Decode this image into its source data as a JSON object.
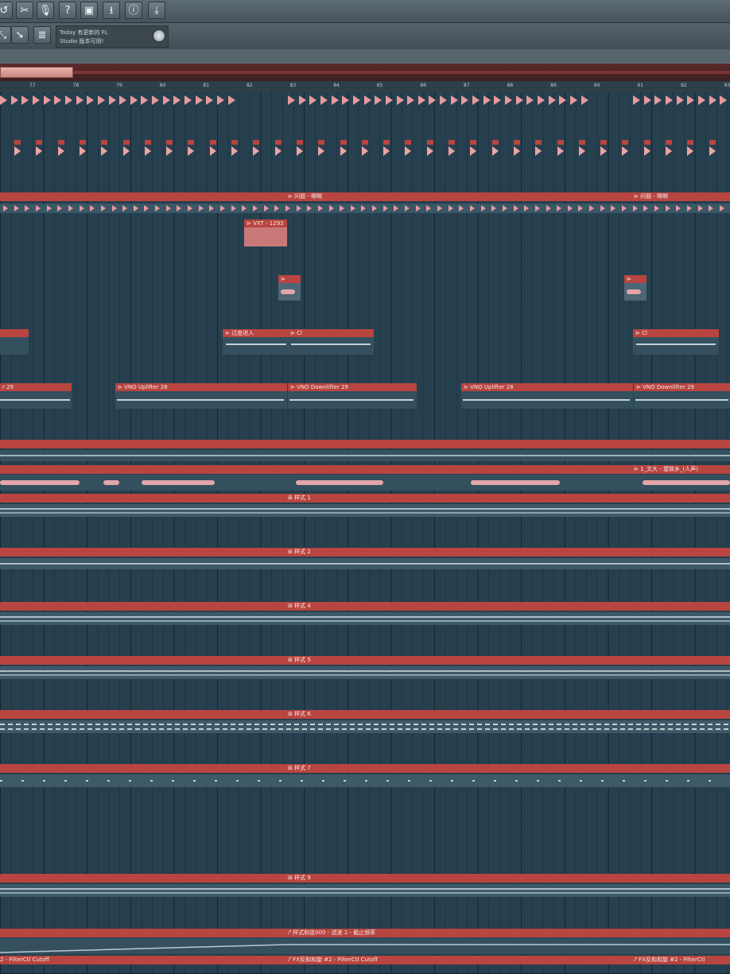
{
  "toolbar": {
    "buttons": [
      {
        "name": "undo-icon",
        "glyph": "↺"
      },
      {
        "name": "cut-icon",
        "glyph": "✂"
      },
      {
        "name": "microphone-icon",
        "glyph": "🎙"
      },
      {
        "name": "help-icon",
        "glyph": "?"
      },
      {
        "name": "save-icon",
        "glyph": "▣"
      },
      {
        "name": "export-icon",
        "glyph": "⭳"
      },
      {
        "name": "info-icon",
        "glyph": "ⓘ"
      },
      {
        "name": "download-icon",
        "glyph": "⤓"
      }
    ]
  },
  "hint_panel": {
    "line1": "Today  有更新的 FL",
    "line2": "Studio 版本可用!"
  },
  "ruler": {
    "labels": [
      "77",
      "78",
      "79",
      "80",
      "81",
      "82",
      "83",
      "84",
      "85",
      "86",
      "87",
      "88",
      "89",
      "90",
      "91",
      "92",
      "93"
    ]
  },
  "clips": {
    "band1_label": "⊳ 问题 - 嘶嘶",
    "band1_label_b": "⊳ 问题 - 嘶嘶",
    "vxt": "⊳ VXT - 1293",
    "transition": "⊳ 过度进入",
    "cl1": "⊳ Cl",
    "cl2": "⊳ Cl",
    "left_29": "r 29",
    "uplifter1": "⊳ VNO Uplifter 28",
    "downlifter1": "⊳ VNO Downlifter 29",
    "uplifter2": "⊳ VNO Uplifter 28",
    "downlifter2": "⊳ VNO Downlifter 29",
    "audio_right": "⊳ 1_文大 - 望故乡_(人声)",
    "pattern1": "⊞ 样式 1",
    "pattern2": "⊞ 样式 2",
    "pattern4": "⊞ 样式 4",
    "pattern5": "⊞ 样式 5",
    "pattern6": "⊞ 样式 6",
    "pattern7": "⊞ 样式 7",
    "pattern9": "⊞ 样式 9",
    "auto1": "⤤ 样式和弦000 - 滤波 1 - 截止频率",
    "auto2_left": "2 - FilterCtl Cutoff",
    "auto2_mid": "⤤ FX反和和旋 #2 - FilterCtl Cutoff",
    "auto2_right": "⤤ FX反和和旋 #2 - FilterCtl"
  }
}
